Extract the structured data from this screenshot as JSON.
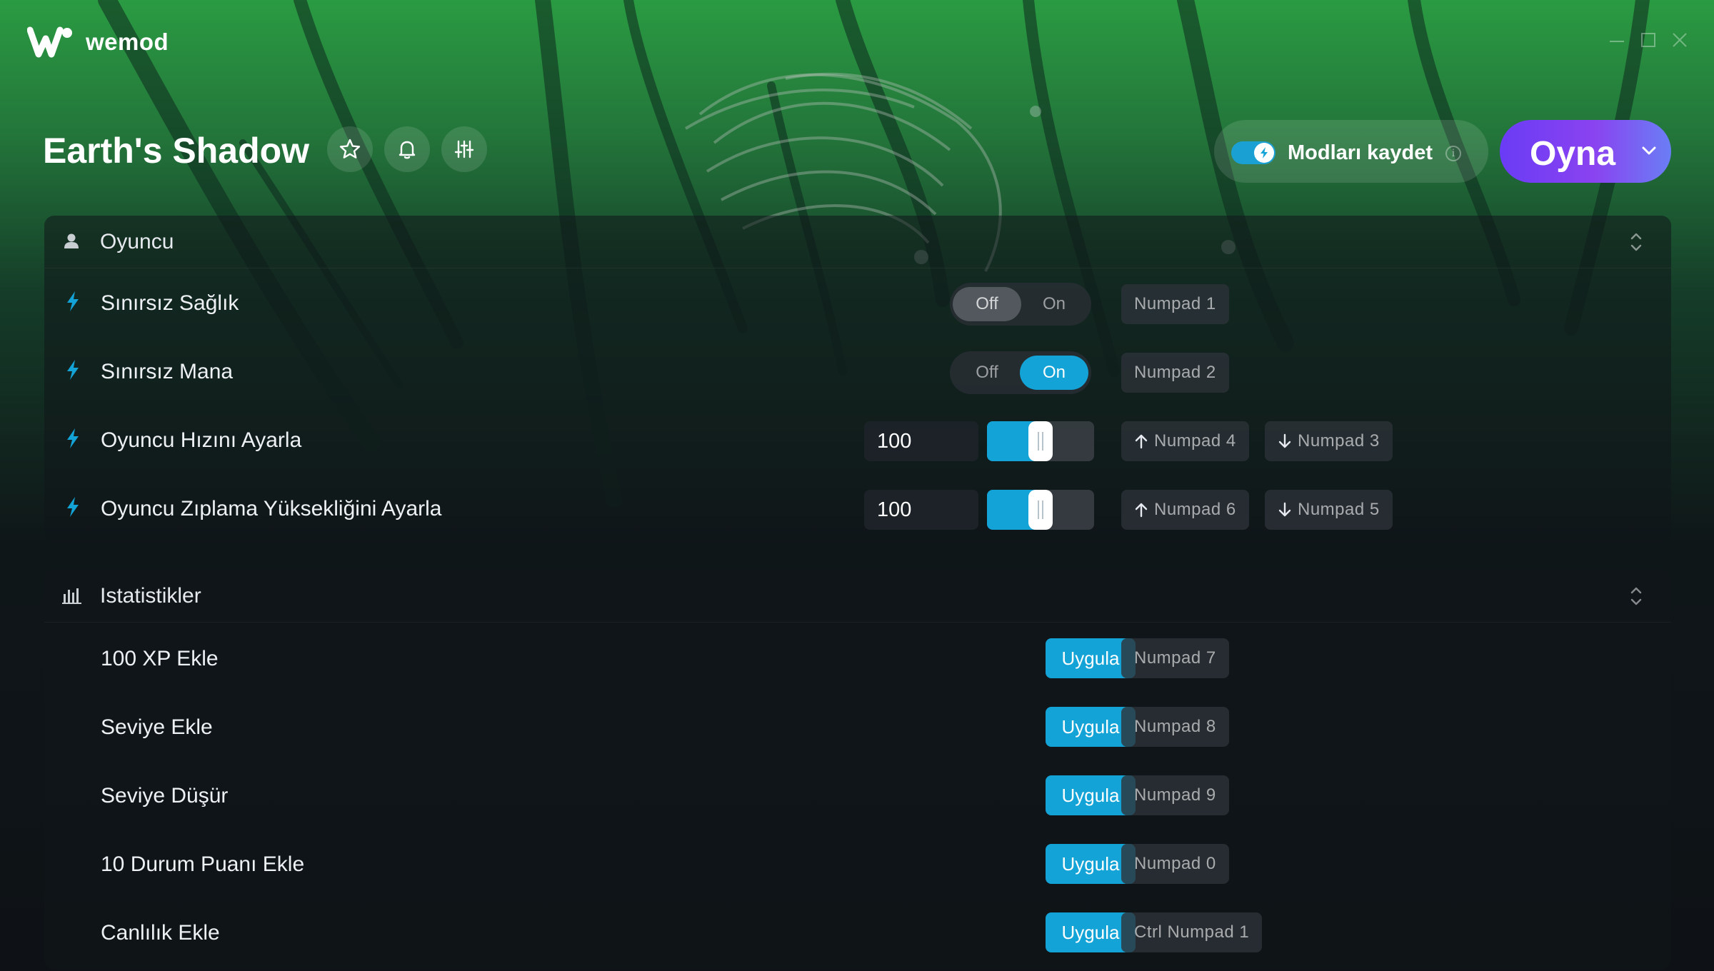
{
  "app": {
    "brand": "wemod",
    "colors": {
      "accent": "#14a3d6",
      "play_gradient_start": "#6a3cf5",
      "play_gradient_end": "#6a7ef5",
      "background_top": "#2a9b42"
    }
  },
  "window_controls": {
    "icons": [
      "minimize-icon",
      "maximize-icon",
      "close-icon"
    ]
  },
  "header": {
    "game_title": "Earth's Shadow",
    "actions": [
      "star-icon",
      "bell-icon",
      "sliders-icon"
    ],
    "save_mods": {
      "label": "Modları kaydet",
      "enabled": true,
      "info": "i"
    },
    "play": {
      "label": "Oyna"
    }
  },
  "sections": [
    {
      "title": "Oyuncu",
      "icon": "user-icon",
      "rows": [
        {
          "label": "Sınırsız Sağlık",
          "type": "toggle",
          "off_label": "Off",
          "on_label": "On",
          "value": "Off",
          "hotkey": "Numpad 1"
        },
        {
          "label": "Sınırsız Mana",
          "type": "toggle",
          "off_label": "Off",
          "on_label": "On",
          "value": "On",
          "hotkey": "Numpad 2"
        },
        {
          "label": "Oyuncu Hızını Ayarla",
          "type": "slider",
          "value": "100",
          "level": 0.5,
          "hotkey_up": "Numpad 4",
          "hotkey_down": "Numpad 3"
        },
        {
          "label": "Oyuncu Zıplama Yüksekliğini Ayarla",
          "type": "slider",
          "value": "100",
          "level": 0.5,
          "hotkey_up": "Numpad 6",
          "hotkey_down": "Numpad 5"
        }
      ]
    },
    {
      "title": "Istatistikler",
      "icon": "bar-chart-icon",
      "rows": [
        {
          "label": "100 XP Ekle",
          "type": "button",
          "button_label": "Uygula",
          "hotkey": "Numpad 7"
        },
        {
          "label": "Seviye Ekle",
          "type": "button",
          "button_label": "Uygula",
          "hotkey": "Numpad 8"
        },
        {
          "label": "Seviye Düşür",
          "type": "button",
          "button_label": "Uygula",
          "hotkey": "Numpad 9"
        },
        {
          "label": "10 Durum Puanı Ekle",
          "type": "button",
          "button_label": "Uygula",
          "hotkey": "Numpad 0"
        },
        {
          "label": "Canlılık Ekle",
          "type": "button",
          "button_label": "Uygula",
          "hotkey": "Ctrl Numpad 1"
        }
      ]
    }
  ]
}
